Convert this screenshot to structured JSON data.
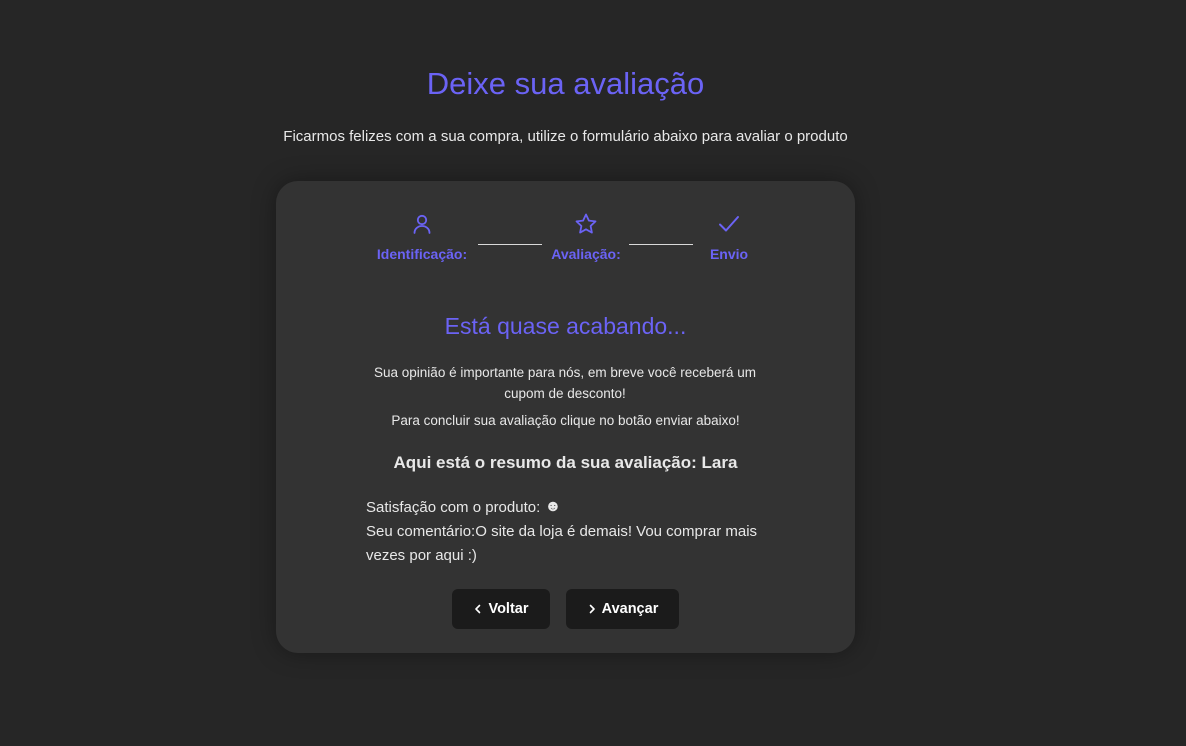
{
  "header": {
    "title": "Deixe sua avaliação",
    "subtitle": "Ficarmos felizes com a sua compra, utilize o formulário abaixo para avaliar o produto"
  },
  "steps": [
    {
      "label": "Identificação:",
      "icon": "user-icon"
    },
    {
      "label": "Avaliação:",
      "icon": "star-icon"
    },
    {
      "label": "Envio",
      "icon": "check-icon"
    }
  ],
  "card": {
    "heading": "Está quase acabando...",
    "text1": "Sua opinião é importante para nós, em breve você receberá um cupom de desconto!",
    "text2": "Para concluir sua avaliação clique no botão enviar abaixo!",
    "summary_title": "Aqui está o resumo da sua avaliação: Lara",
    "satisfaction_label": "Satisfação com o produto:",
    "satisfaction_value": "☻",
    "comment_label": "Seu comentário:",
    "comment_value": "O site da loja é demais! Vou comprar mais vezes por aqui :)"
  },
  "buttons": {
    "back_label": "Voltar",
    "next_label": "Avançar"
  },
  "colors": {
    "accent": "#6b63f5",
    "background": "#262626",
    "card": "#333333",
    "button": "#1b1b1b"
  }
}
